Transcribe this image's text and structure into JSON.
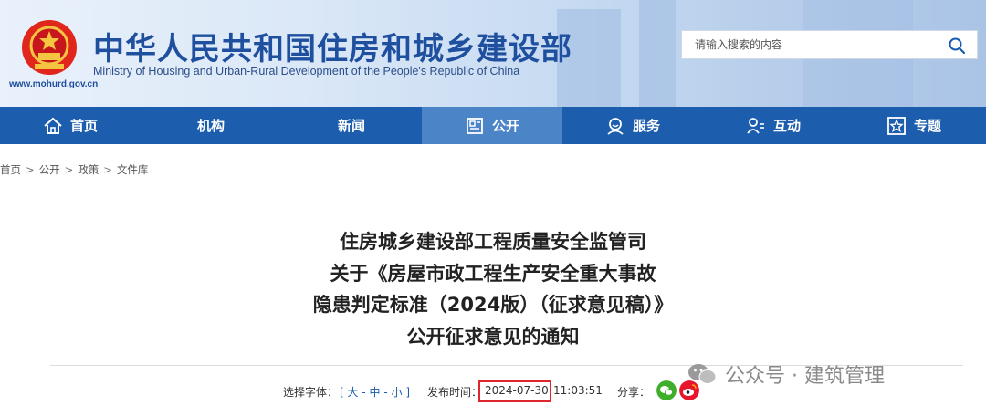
{
  "header": {
    "site_title": "中华人民共和国住房和城乡建设部",
    "site_subtitle": "Ministry of Housing and Urban-Rural Development of the People's Republic of China",
    "site_url": "www.mohurd.gov.cn",
    "search_placeholder": "请输入搜索的内容"
  },
  "nav": {
    "items": [
      {
        "label": "首页",
        "icon": "home-icon"
      },
      {
        "label": "机构",
        "icon": ""
      },
      {
        "label": "新闻",
        "icon": ""
      },
      {
        "label": "公开",
        "icon": "document-icon"
      },
      {
        "label": "服务",
        "icon": "service-icon"
      },
      {
        "label": "互动",
        "icon": "interaction-icon"
      },
      {
        "label": "专题",
        "icon": "star-icon"
      }
    ],
    "active_index": 3
  },
  "breadcrumb": [
    "首页",
    "公开",
    "政策",
    "文件库"
  ],
  "article": {
    "title_lines": [
      "住房城乡建设部工程质量安全监管司",
      "关于《房屋市政工程生产安全重大事故",
      "隐患判定标准（2024版）（征求意见稿）》",
      "公开征求意见的通知"
    ],
    "font_size_label": "选择字体：",
    "font_size_options": [
      "大",
      "中",
      "小"
    ],
    "publish_label": "发布时间：",
    "publish_date": "2024-07-30",
    "publish_time": "11:03:51",
    "share_label": "分享："
  },
  "watermark": {
    "text": "公众号 · 建筑管理"
  },
  "colors": {
    "brand_blue": "#1d5dae",
    "nav_active": "#4c84c8",
    "highlight_red": "#e0252c"
  }
}
